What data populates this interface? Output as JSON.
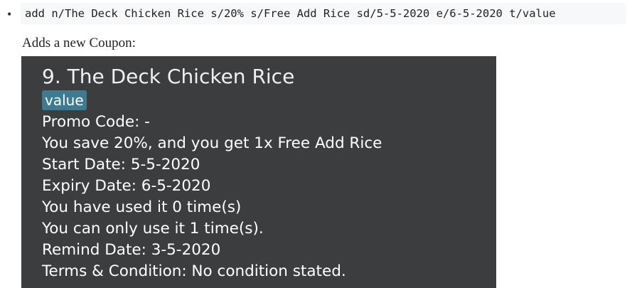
{
  "command": "add n/The Deck Chicken Rice s/20% s/Free Add Rice sd/5-5-2020 e/6-5-2020 t/value",
  "description": "Adds a new Coupon:",
  "coupon": {
    "title": "9.  The Deck Chicken Rice",
    "tag": "value",
    "lines": [
      "Promo Code: -",
      "You save 20%,  and you get 1x Free Add Rice",
      "Start Date: 5-5-2020",
      "Expiry Date: 6-5-2020",
      "You have used it 0 time(s)",
      "You can only use it 1 time(s).",
      "Remind Date: 3-5-2020",
      "Terms & Condition: No condition stated."
    ]
  }
}
